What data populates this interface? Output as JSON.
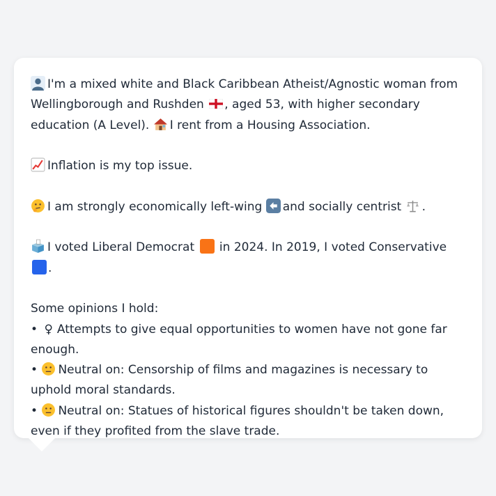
{
  "profile": {
    "intro": "I'm a mixed white and Black Caribbean Atheist/Agnostic woman from Wellingborough and Rushden",
    "intro_tail": ", aged 53, with higher secondary education (A Level).",
    "housing": "I rent from a Housing Association.",
    "issue": "Inflation is my top issue.",
    "ideology_a": "I am strongly economically left-wing",
    "ideology_b": "and socially centrist",
    "ideology_end": ".",
    "vote_a": "I voted Liberal Democrat",
    "vote_b": "in 2024. In 2019, I voted Conservative",
    "vote_end": "."
  },
  "opinions": {
    "heading": "Some opinions I hold:",
    "items": [
      {
        "bullet": "•",
        "icon": "female-sign",
        "text": "Attempts to give equal opportunities to women have not gone far enough."
      },
      {
        "bullet": "•",
        "icon": "neutral-face",
        "text": "Neutral on: Censorship of films and magazines is necessary to uphold moral standards."
      },
      {
        "bullet": "•",
        "icon": "neutral-face",
        "text": "Neutral on: Statues of historical figures shouldn't be taken down, even if they profited from the slave trade."
      }
    ]
  },
  "colors": {
    "lib_dem": "#f97316",
    "conservative": "#2563eb",
    "bubble_bg": "#ffffff",
    "page_bg": "#f3f4f6"
  },
  "icons": [
    "person-silhouette-icon",
    "england-flag-icon",
    "house-icon",
    "chart-increasing-icon",
    "thinking-face-icon",
    "left-arrow-icon",
    "balance-scale-icon",
    "ballot-box-icon",
    "orange-square-icon",
    "blue-square-icon",
    "female-sign-icon",
    "neutral-face-icon"
  ]
}
